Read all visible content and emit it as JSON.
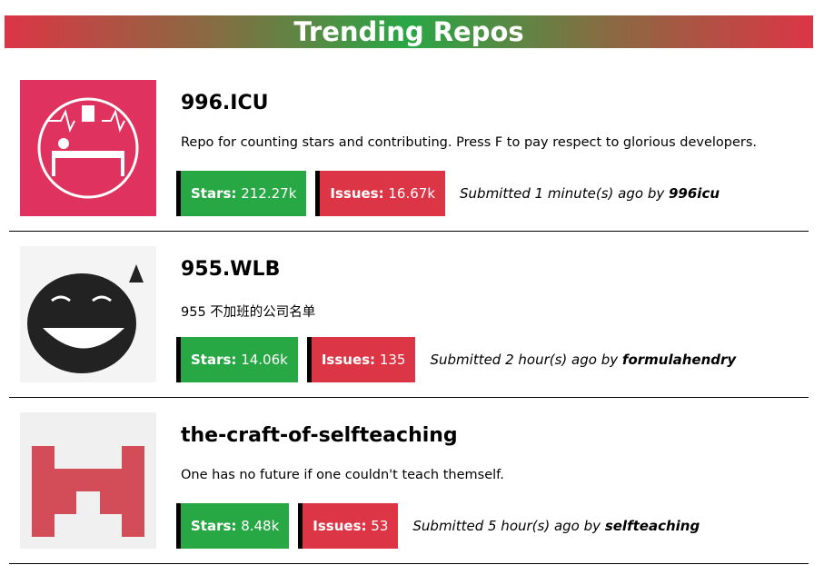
{
  "header": {
    "title": "Trending Repos"
  },
  "labels": {
    "stars": "Stars:",
    "issues": "Issues:",
    "by": "by"
  },
  "repos": [
    {
      "name": "996.ICU",
      "description": "Repo for counting stars and contributing. Press F to pay respect to glorious developers.",
      "stars": "212.27k",
      "issues": "16.67k",
      "submitted": "Submitted 1 minute(s) ago",
      "author": "996icu"
    },
    {
      "name": "955.WLB",
      "description": "955 不加班的公司名单",
      "stars": "14.06k",
      "issues": "135",
      "submitted": "Submitted 2 hour(s) ago",
      "author": "formulahendry"
    },
    {
      "name": "the-craft-of-selfteaching",
      "description": "One has no future if one couldn't teach themself.",
      "stars": "8.48k",
      "issues": "53",
      "submitted": "Submitted 5 hour(s) ago",
      "author": "selfteaching"
    }
  ]
}
